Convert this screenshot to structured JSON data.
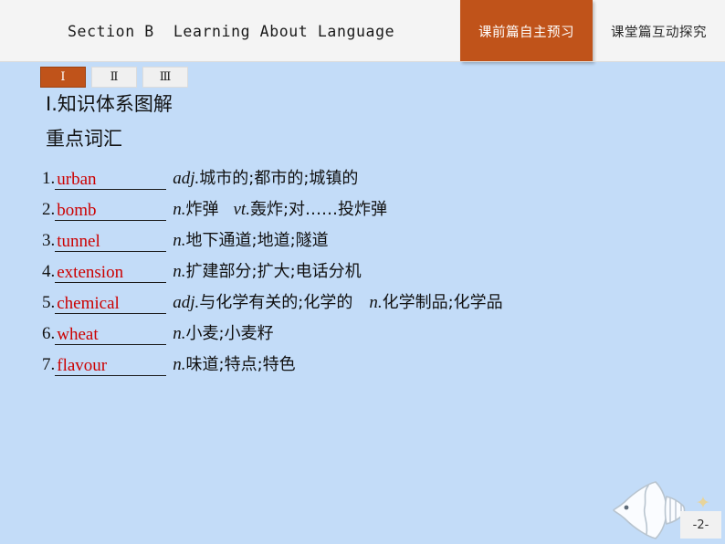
{
  "header": {
    "title": "Section B  Learning About Language",
    "tabs": [
      {
        "label": "课前篇自主预习",
        "active": true
      },
      {
        "label": "课堂篇互动探究",
        "active": false
      }
    ],
    "active_color": "#c0531a",
    "background": "#f4f4f4"
  },
  "numeral_tabs": [
    {
      "label": "Ⅰ",
      "active": true
    },
    {
      "label": "Ⅱ",
      "active": false
    },
    {
      "label": "Ⅲ",
      "active": false
    }
  ],
  "content": {
    "section_title": "Ⅰ.知识体系图解",
    "sub_title": "重点词汇",
    "vocab": [
      {
        "num": "1.",
        "word": "urban",
        "pos": "adj.",
        "def": "城市的;都市的;城镇的",
        "pos2": "",
        "def2": ""
      },
      {
        "num": "2.",
        "word": "bomb",
        "pos": "n.",
        "def": "炸弹",
        "pos2": "vt.",
        "def2": "轰炸;对……投炸弹"
      },
      {
        "num": "3.",
        "word": "tunnel",
        "pos": "n.",
        "def": "地下通道;地道;隧道",
        "pos2": "",
        "def2": ""
      },
      {
        "num": "4.",
        "word": "extension",
        "pos": "n.",
        "def": "扩建部分;扩大;电话分机",
        "pos2": "",
        "def2": ""
      },
      {
        "num": "5.",
        "word": "chemical",
        "pos": "adj.",
        "def": "与化学有关的;化学的",
        "pos2": "n.",
        "def2": "化学制品;化学品"
      },
      {
        "num": "6.",
        "word": "wheat",
        "pos": "n.",
        "def": "小麦;小麦籽",
        "pos2": "",
        "def2": ""
      },
      {
        "num": "7.",
        "word": "flavour",
        "pos": "n.",
        "def": "味道;特点;特色",
        "pos2": "",
        "def2": ""
      }
    ],
    "word_color": "#cc0000"
  },
  "decor": {
    "fish_label": "fish",
    "star_glyph": "✦",
    "page_number": "-2-"
  },
  "page": {
    "background": "#c3dcf8"
  }
}
